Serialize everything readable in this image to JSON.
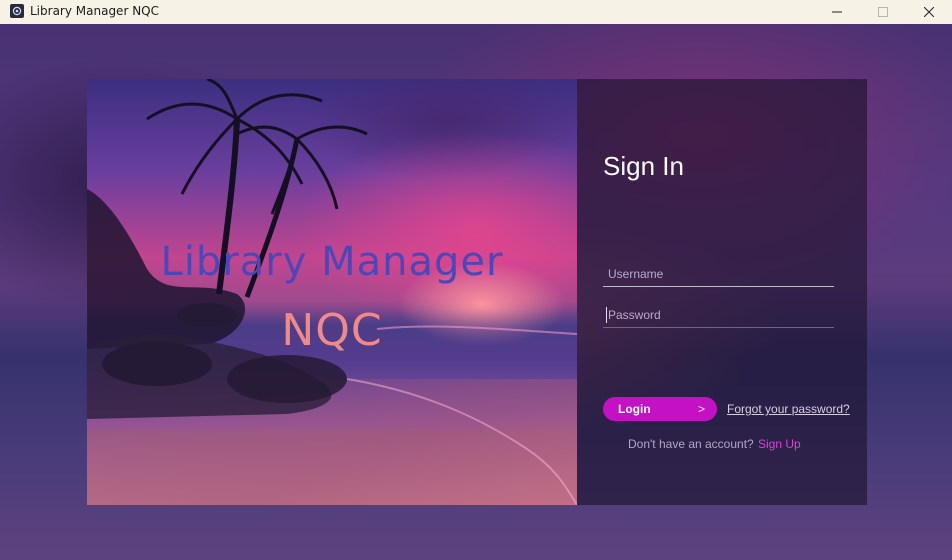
{
  "window": {
    "title": "Library Manager NQC",
    "icon": "app-icon",
    "controls": {
      "minimize": "minimize-icon",
      "maximize": "maximize-icon",
      "close": "close-icon"
    }
  },
  "hero": {
    "title": "Library Manager",
    "subtitle": "NQC"
  },
  "signin": {
    "heading": "Sign In",
    "username_placeholder": "Username",
    "username_value": "",
    "password_placeholder": "Password",
    "password_value": "",
    "login_label": "Login",
    "login_arrow": ">",
    "forgot_label": "Forgot your password?",
    "no_account_label": "Don't have an account?",
    "signup_label": "Sign Up"
  },
  "colors": {
    "accent": "#c411c4",
    "signup_link": "#e13fd8",
    "password_underline": "#c02fc4",
    "hero_title": "#4a48b8",
    "hero_subtitle": "#f08a88"
  }
}
